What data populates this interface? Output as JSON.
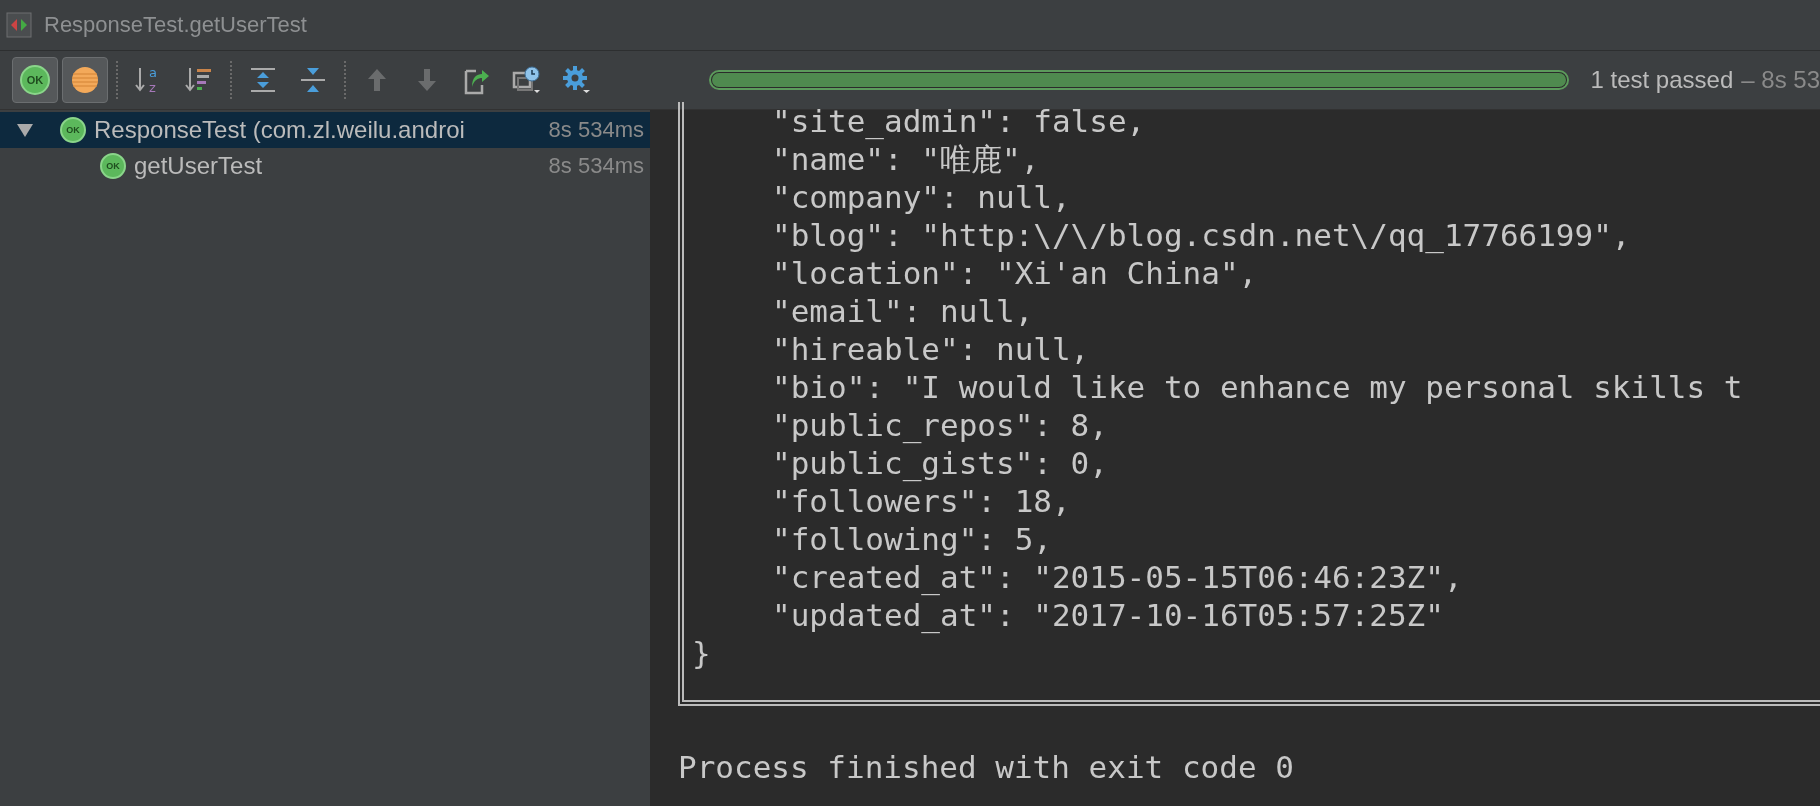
{
  "window": {
    "title": "ResponseTest.getUserTest"
  },
  "toolbar": {
    "buttons": [
      {
        "kind": "ok-filter",
        "label": "OK",
        "selected": true,
        "disabled": false
      },
      {
        "kind": "ignored-filter",
        "selected": true,
        "disabled": false
      },
      {
        "kind": "separator"
      },
      {
        "kind": "sort-alpha",
        "glyphs": [
          "a",
          "z"
        ],
        "selected": false,
        "disabled": false
      },
      {
        "kind": "sort-duration",
        "selected": false,
        "disabled": false
      },
      {
        "kind": "separator"
      },
      {
        "kind": "expand-all",
        "selected": false,
        "disabled": false
      },
      {
        "kind": "collapse-all",
        "selected": false,
        "disabled": false
      },
      {
        "kind": "separator"
      },
      {
        "kind": "up",
        "selected": false,
        "disabled": true
      },
      {
        "kind": "down",
        "selected": false,
        "disabled": true
      },
      {
        "kind": "export",
        "selected": false,
        "disabled": false
      },
      {
        "kind": "history",
        "selected": false,
        "disabled": false
      },
      {
        "kind": "settings",
        "selected": false,
        "disabled": false
      }
    ]
  },
  "progress": {
    "level": 1,
    "status": "1 test passed",
    "duration": "– 8s 53"
  },
  "tree": [
    {
      "name": "ResponseTest (com.zl.weilu.androi",
      "badge": "OK",
      "time": "8s 534ms",
      "expanded": true,
      "selected": true,
      "children": [
        {
          "name": "getUserTest",
          "badge": "OK",
          "time": "8s 534ms",
          "selected": false
        }
      ]
    }
  ],
  "console": {
    "entries": [
      "\"site_admin\": false,",
      "\"name\": \"唯鹿\",",
      "\"company\": null,",
      "\"blog\": \"http:\\/\\/blog.csdn.net\\/qq_17766199\",",
      "\"location\": \"Xi'an China\",",
      "\"email\": null,",
      "\"hireable\": null,",
      "\"bio\": \"I would like to enhance my personal skills t",
      "\"public_repos\": 8,",
      "\"public_gists\": 0,",
      "\"followers\": 18,",
      "\"following\": 5,",
      "\"created_at\": \"2015-05-15T06:46:23Z\",",
      "\"updated_at\": \"2017-10-16T05:57:25Z\""
    ],
    "closing": "}",
    "exit": "Process finished with exit code 0"
  }
}
